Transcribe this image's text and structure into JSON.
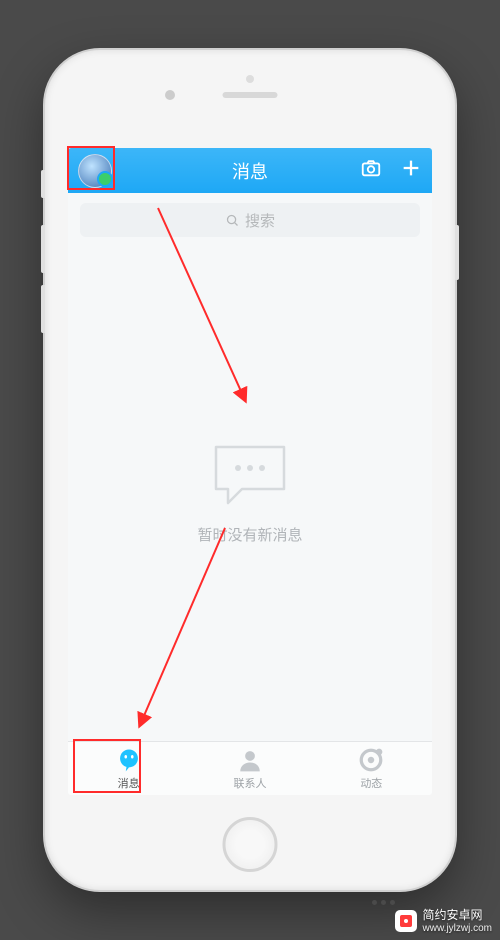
{
  "navbar": {
    "title": "消息",
    "avatar_status": "online"
  },
  "search": {
    "placeholder": "搜索"
  },
  "empty_state": {
    "text": "暂时没有新消息"
  },
  "tabs": [
    {
      "label": "消息",
      "active": true
    },
    {
      "label": "联系人",
      "active": false
    },
    {
      "label": "动态",
      "active": false
    }
  ],
  "watermark": {
    "brand": "简约安卓网",
    "url": "www.jylzwj.com"
  }
}
